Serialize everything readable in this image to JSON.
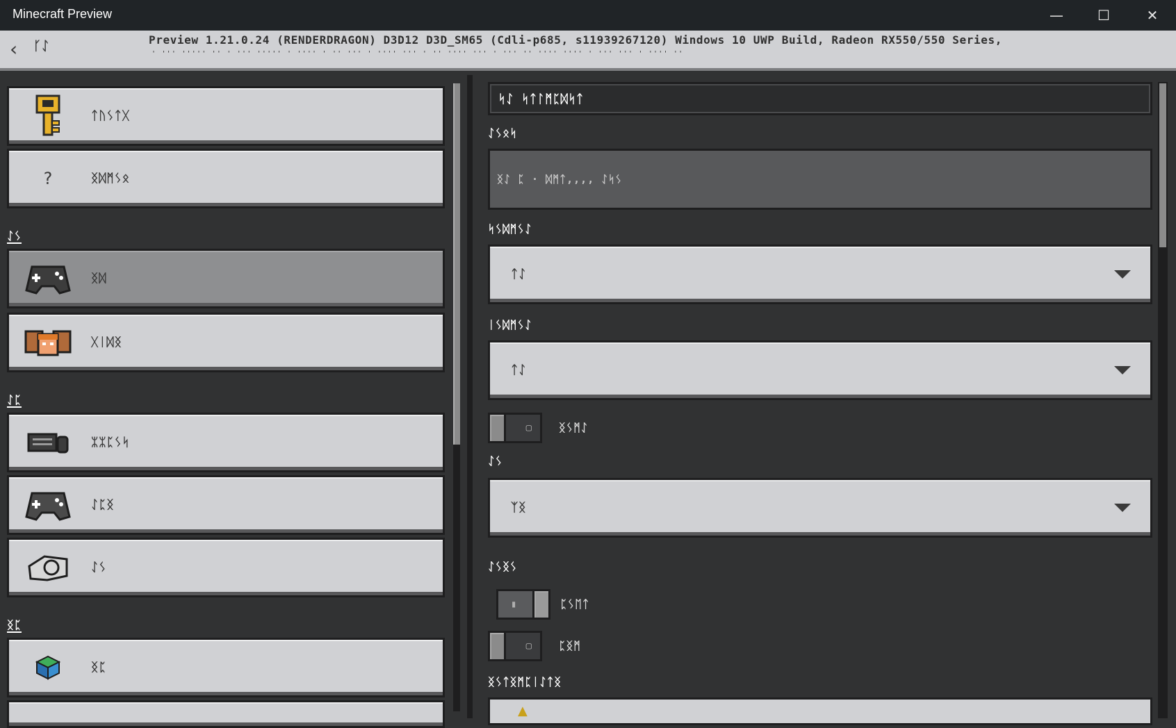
{
  "window": {
    "title": "Minecraft Preview",
    "minimize": "—",
    "maximize": "☐",
    "close": "✕"
  },
  "header": {
    "back_icon": "chevron-left-icon",
    "title": "ᚴᛇ",
    "version_line": "Preview 1.21.0.24 (RENDERDRAGON) D3D12 D3D_SM65 (Cdli-p685, s11939267120) Windows 10 UWP Build, Radeon RX550/550 Series,",
    "version_subline": "' ''' ''''' '' ' ''' ''''' ' '''' ' '' ''' ' '''' ''' ' '' '''' ''' ' ''' '' '''' '''' ' ''' ''' ' '''' ''"
  },
  "sidebar": {
    "items": [
      {
        "icon": "key-icon",
        "label": "ᛏᚢᛊᛏᚷ"
      },
      {
        "icon": "question-icon",
        "label": "ᛝᛞᛗᛊᛟ"
      }
    ],
    "sections": [
      {
        "heading": "ᛇᛊ",
        "items": [
          {
            "icon": "controller-icon",
            "label": "ᛝᛞ",
            "selected": true
          },
          {
            "icon": "players-icon",
            "label": "ᚷᛁᛞᛝ"
          }
        ]
      },
      {
        "heading": "ᛇᛈ",
        "items": [
          {
            "icon": "keyboard-mouse-icon",
            "label": "ᛯᛯᛈᛊᛋ"
          },
          {
            "icon": "controller-icon",
            "label": "ᛇᛈᛝ"
          },
          {
            "icon": "touch-icon",
            "label": "ᛇᛊ"
          }
        ]
      },
      {
        "heading": "ᛝᛈ",
        "items": [
          {
            "icon": "world-cube-icon",
            "label": "ᛝᛈ"
          }
        ]
      }
    ]
  },
  "main": {
    "name_field_value": "ᛋᛇ ᛋᛏᛚᛗᛈᛞᛋᛏ",
    "readonly_label": "ᛇᛊᛟᛋ",
    "readonly_value": "ᛝᛇ ᛈ · ᛞᛗᛏ,,,, ᛇᛋᛊ",
    "dropdown1_label": "ᛋᛊᛞᛗᛊᛇ",
    "dropdown1_value": "ᛏᛇ",
    "dropdown2_label": "ᛁᛊᛞᛗᛊᛇ",
    "dropdown2_value": "ᛏᛇ",
    "toggle1_label": "ᛝᛊᛗᛇ",
    "toggle1_mark": "▢",
    "dropdown3_label": "ᛇᛊ",
    "dropdown3_value": "ᛉᛝ",
    "section2_label": "ᛇᛊᛝᛊ",
    "toggle2_label": "ᛈᛊᛖᛏ",
    "toggle2_mark": "▮",
    "toggle3_label": "ᛈᛝᛗ",
    "toggle3_mark": "▢",
    "section3_label": "ᛝᛊᛏᛝᛗᛈᛁᛇᛏᛝ",
    "bottom_icon": "▲"
  },
  "colors": {
    "background": "#313233",
    "titlebar": "#202427",
    "button_face": "#d0d1d4",
    "button_selected": "#8e8f91",
    "border": "#1e1e1f"
  }
}
